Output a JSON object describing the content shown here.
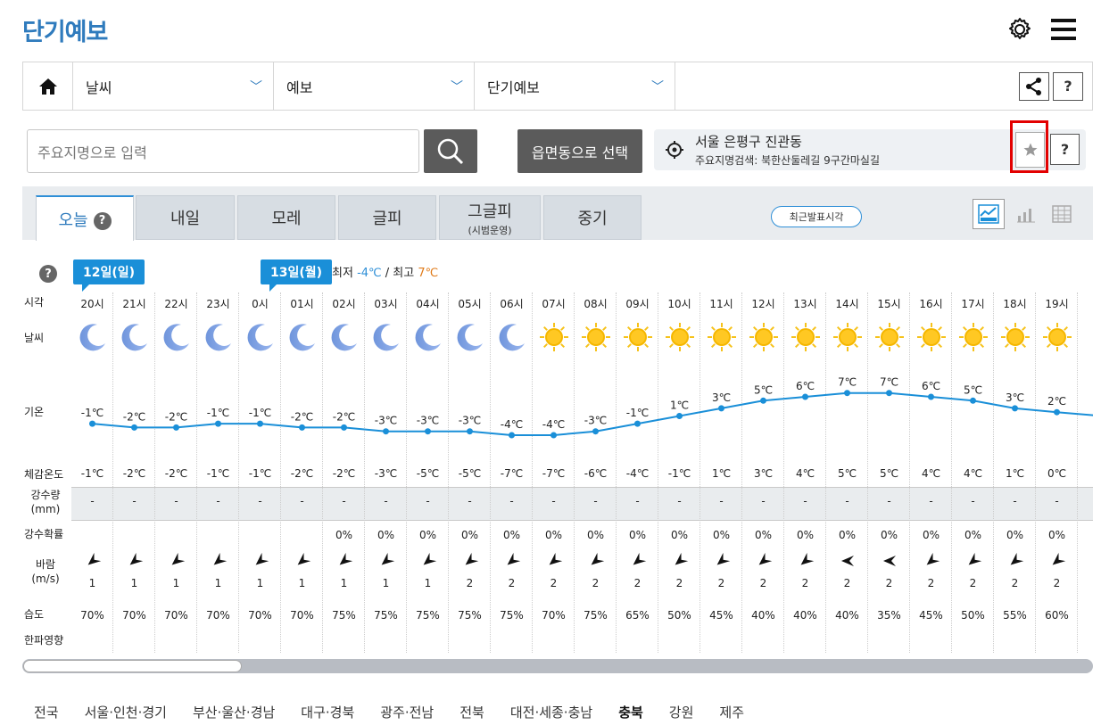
{
  "page": {
    "title": "단기예보"
  },
  "nav": {
    "selects": [
      "날씨",
      "예보",
      "단기예보"
    ],
    "help_label": "?"
  },
  "search": {
    "placeholder": "주요지명으로 입력",
    "region_button": "읍면동으로 선택"
  },
  "location": {
    "main": "서울 은평구 진관동",
    "sub": "주요지명검색: 북한산둘레길 9구간마실길",
    "help_label": "?"
  },
  "tabs": [
    {
      "label": "오늘",
      "sub": ""
    },
    {
      "label": "내일",
      "sub": ""
    },
    {
      "label": "모레",
      "sub": ""
    },
    {
      "label": "글피",
      "sub": ""
    },
    {
      "label": "그글피",
      "sub": "(시범운영)"
    },
    {
      "label": "중기",
      "sub": ""
    }
  ],
  "recent_button": "최근발표시각",
  "forecast": {
    "help_label": "?",
    "day_flags": [
      "12일(일)",
      "13일(월)"
    ],
    "minmax": {
      "min_label": "최저",
      "min": "-4℃",
      "sep": "/",
      "max_label": "최고",
      "max": "7℃"
    },
    "row_labels": {
      "time": "시각",
      "weather": "날씨",
      "temp": "기온",
      "feels": "체감온도",
      "rain_amt": "강수량",
      "rain_unit": "(mm)",
      "rain_prob": "강수확률",
      "wind": "바람",
      "wind_unit": "(m/s)",
      "humidity": "습도",
      "cold": "한파영향"
    },
    "hours": [
      "20시",
      "21시",
      "22시",
      "23시",
      "0시",
      "01시",
      "02시",
      "03시",
      "04시",
      "05시",
      "06시",
      "07시",
      "08시",
      "09시",
      "10시",
      "11시",
      "12시",
      "13시",
      "14시",
      "15시",
      "16시",
      "17시",
      "18시",
      "19시"
    ],
    "weather": [
      "moon-icon",
      "moon-icon",
      "moon-icon",
      "moon-icon",
      "moon-icon",
      "moon-icon",
      "moon-icon",
      "moon-icon",
      "moon-icon",
      "moon-icon",
      "moon-icon",
      "sun-icon",
      "sun-icon",
      "sun-icon",
      "sun-icon",
      "sun-icon",
      "sun-icon",
      "sun-icon",
      "sun-icon",
      "sun-icon",
      "sun-icon",
      "sun-icon",
      "sun-icon",
      "sun-icon"
    ],
    "temps": [
      -1,
      -2,
      -2,
      -1,
      -1,
      -2,
      -2,
      -3,
      -3,
      -3,
      -4,
      -4,
      -3,
      -1,
      1,
      3,
      5,
      6,
      7,
      7,
      6,
      5,
      3,
      2
    ],
    "temp_labels": [
      "-1℃",
      "-2℃",
      "-2℃",
      "-1℃",
      "-1℃",
      "-2℃",
      "-2℃",
      "-3℃",
      "-3℃",
      "-3℃",
      "-4℃",
      "-4℃",
      "-3℃",
      "-1℃",
      "1℃",
      "3℃",
      "5℃",
      "6℃",
      "7℃",
      "7℃",
      "6℃",
      "5℃",
      "3℃",
      "2℃"
    ],
    "feels": [
      "-1℃",
      "-2℃",
      "-2℃",
      "-1℃",
      "-1℃",
      "-2℃",
      "-2℃",
      "-3℃",
      "-5℃",
      "-5℃",
      "-7℃",
      "-7℃",
      "-6℃",
      "-4℃",
      "-1℃",
      "1℃",
      "3℃",
      "4℃",
      "5℃",
      "5℃",
      "4℃",
      "4℃",
      "1℃",
      "0℃"
    ],
    "rain_amt": [
      "-",
      "-",
      "-",
      "-",
      "-",
      "-",
      "-",
      "-",
      "-",
      "-",
      "-",
      "-",
      "-",
      "-",
      "-",
      "-",
      "-",
      "-",
      "-",
      "-",
      "-",
      "-",
      "-",
      "-"
    ],
    "rain_prob": [
      "",
      "",
      "",
      "",
      "",
      "",
      "0%",
      "0%",
      "0%",
      "0%",
      "0%",
      "0%",
      "0%",
      "0%",
      "0%",
      "0%",
      "0%",
      "0%",
      "0%",
      "0%",
      "0%",
      "0%",
      "0%",
      "0%"
    ],
    "wind_dir": [
      "nw",
      "nw",
      "nw",
      "nw",
      "nw",
      "nw",
      "nw",
      "nw",
      "nw",
      "nw",
      "nw",
      "nw",
      "nw",
      "nw",
      "nw",
      "nw",
      "nw",
      "nw",
      "w",
      "w",
      "nw",
      "nw",
      "nw",
      "nw"
    ],
    "wind_speed": [
      "1",
      "1",
      "1",
      "1",
      "1",
      "1",
      "1",
      "1",
      "1",
      "2",
      "2",
      "2",
      "2",
      "2",
      "2",
      "2",
      "2",
      "2",
      "2",
      "2",
      "2",
      "2",
      "2",
      "2"
    ],
    "humidity": [
      "70%",
      "70%",
      "70%",
      "70%",
      "70%",
      "70%",
      "75%",
      "75%",
      "75%",
      "75%",
      "75%",
      "70%",
      "75%",
      "65%",
      "50%",
      "45%",
      "40%",
      "40%",
      "40%",
      "35%",
      "45%",
      "50%",
      "55%",
      "60%"
    ]
  },
  "regions": [
    "전국",
    "서울·인천·경기",
    "부산·울산·경남",
    "대구·경북",
    "광주·전남",
    "전북",
    "대전·세종·충남",
    "충북",
    "강원",
    "제주"
  ],
  "active_region": "충북",
  "colors": {
    "accent": "#2f7bbd",
    "tab_active": "#1a8fd8",
    "line": "#1a8fd8",
    "min": "#2f8fd7",
    "max": "#e07b1a",
    "highlight": "#e30000"
  }
}
